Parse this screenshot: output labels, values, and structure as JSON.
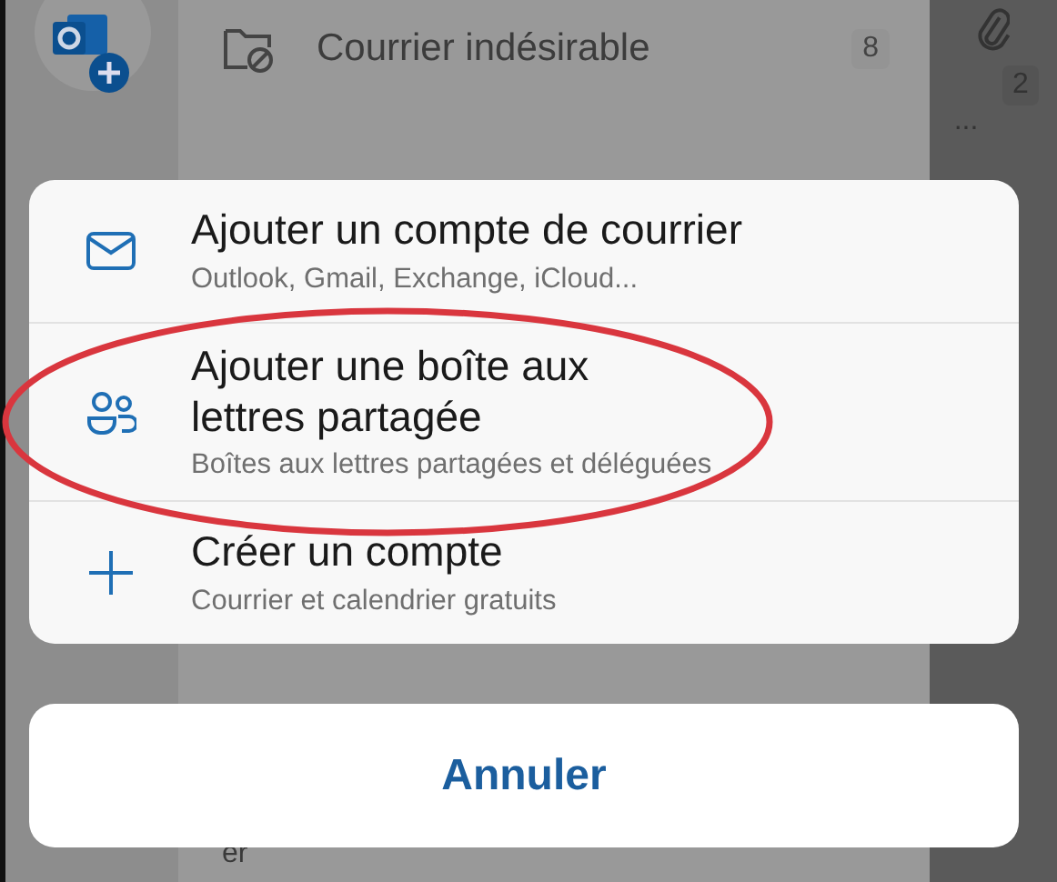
{
  "background": {
    "folder": {
      "label": "Courrier indésirable",
      "count": "8"
    },
    "message_count": "2",
    "more": "...",
    "cut_text": "er"
  },
  "sheet": {
    "items": [
      {
        "kind": "mail",
        "title": "Ajouter un compte de courrier",
        "subtitle": "Outlook, Gmail, Exchange, iCloud..."
      },
      {
        "kind": "people",
        "title": "Ajouter une boîte aux\nlettres partagée",
        "subtitle": "Boîtes aux lettres partagées et déléguées"
      },
      {
        "kind": "plus",
        "title": "Créer un compte",
        "subtitle": "Courrier et calendrier gratuits"
      }
    ],
    "cancel": "Annuler"
  },
  "annotation": {
    "kind": "ellipse"
  }
}
